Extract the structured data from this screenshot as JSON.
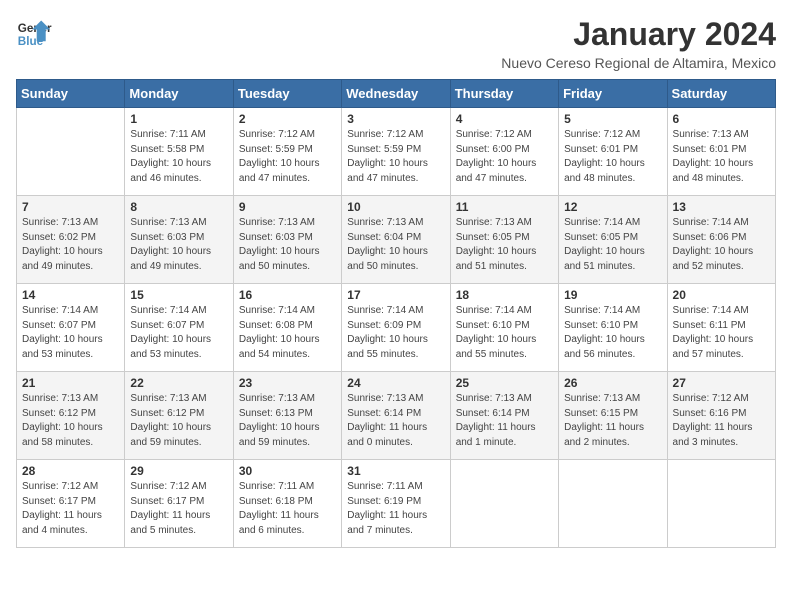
{
  "logo": {
    "line1": "General",
    "line2": "Blue"
  },
  "title": "January 2024",
  "subtitle": "Nuevo Cereso Regional de Altamira, Mexico",
  "days_header": [
    "Sunday",
    "Monday",
    "Tuesday",
    "Wednesday",
    "Thursday",
    "Friday",
    "Saturday"
  ],
  "weeks": [
    [
      {
        "day": "",
        "info": ""
      },
      {
        "day": "1",
        "info": "Sunrise: 7:11 AM\nSunset: 5:58 PM\nDaylight: 10 hours\nand 46 minutes."
      },
      {
        "day": "2",
        "info": "Sunrise: 7:12 AM\nSunset: 5:59 PM\nDaylight: 10 hours\nand 47 minutes."
      },
      {
        "day": "3",
        "info": "Sunrise: 7:12 AM\nSunset: 5:59 PM\nDaylight: 10 hours\nand 47 minutes."
      },
      {
        "day": "4",
        "info": "Sunrise: 7:12 AM\nSunset: 6:00 PM\nDaylight: 10 hours\nand 47 minutes."
      },
      {
        "day": "5",
        "info": "Sunrise: 7:12 AM\nSunset: 6:01 PM\nDaylight: 10 hours\nand 48 minutes."
      },
      {
        "day": "6",
        "info": "Sunrise: 7:13 AM\nSunset: 6:01 PM\nDaylight: 10 hours\nand 48 minutes."
      }
    ],
    [
      {
        "day": "7",
        "info": "Sunrise: 7:13 AM\nSunset: 6:02 PM\nDaylight: 10 hours\nand 49 minutes."
      },
      {
        "day": "8",
        "info": "Sunrise: 7:13 AM\nSunset: 6:03 PM\nDaylight: 10 hours\nand 49 minutes."
      },
      {
        "day": "9",
        "info": "Sunrise: 7:13 AM\nSunset: 6:03 PM\nDaylight: 10 hours\nand 50 minutes."
      },
      {
        "day": "10",
        "info": "Sunrise: 7:13 AM\nSunset: 6:04 PM\nDaylight: 10 hours\nand 50 minutes."
      },
      {
        "day": "11",
        "info": "Sunrise: 7:13 AM\nSunset: 6:05 PM\nDaylight: 10 hours\nand 51 minutes."
      },
      {
        "day": "12",
        "info": "Sunrise: 7:14 AM\nSunset: 6:05 PM\nDaylight: 10 hours\nand 51 minutes."
      },
      {
        "day": "13",
        "info": "Sunrise: 7:14 AM\nSunset: 6:06 PM\nDaylight: 10 hours\nand 52 minutes."
      }
    ],
    [
      {
        "day": "14",
        "info": "Sunrise: 7:14 AM\nSunset: 6:07 PM\nDaylight: 10 hours\nand 53 minutes."
      },
      {
        "day": "15",
        "info": "Sunrise: 7:14 AM\nSunset: 6:07 PM\nDaylight: 10 hours\nand 53 minutes."
      },
      {
        "day": "16",
        "info": "Sunrise: 7:14 AM\nSunset: 6:08 PM\nDaylight: 10 hours\nand 54 minutes."
      },
      {
        "day": "17",
        "info": "Sunrise: 7:14 AM\nSunset: 6:09 PM\nDaylight: 10 hours\nand 55 minutes."
      },
      {
        "day": "18",
        "info": "Sunrise: 7:14 AM\nSunset: 6:10 PM\nDaylight: 10 hours\nand 55 minutes."
      },
      {
        "day": "19",
        "info": "Sunrise: 7:14 AM\nSunset: 6:10 PM\nDaylight: 10 hours\nand 56 minutes."
      },
      {
        "day": "20",
        "info": "Sunrise: 7:14 AM\nSunset: 6:11 PM\nDaylight: 10 hours\nand 57 minutes."
      }
    ],
    [
      {
        "day": "21",
        "info": "Sunrise: 7:13 AM\nSunset: 6:12 PM\nDaylight: 10 hours\nand 58 minutes."
      },
      {
        "day": "22",
        "info": "Sunrise: 7:13 AM\nSunset: 6:12 PM\nDaylight: 10 hours\nand 59 minutes."
      },
      {
        "day": "23",
        "info": "Sunrise: 7:13 AM\nSunset: 6:13 PM\nDaylight: 10 hours\nand 59 minutes."
      },
      {
        "day": "24",
        "info": "Sunrise: 7:13 AM\nSunset: 6:14 PM\nDaylight: 11 hours\nand 0 minutes."
      },
      {
        "day": "25",
        "info": "Sunrise: 7:13 AM\nSunset: 6:14 PM\nDaylight: 11 hours\nand 1 minute."
      },
      {
        "day": "26",
        "info": "Sunrise: 7:13 AM\nSunset: 6:15 PM\nDaylight: 11 hours\nand 2 minutes."
      },
      {
        "day": "27",
        "info": "Sunrise: 7:12 AM\nSunset: 6:16 PM\nDaylight: 11 hours\nand 3 minutes."
      }
    ],
    [
      {
        "day": "28",
        "info": "Sunrise: 7:12 AM\nSunset: 6:17 PM\nDaylight: 11 hours\nand 4 minutes."
      },
      {
        "day": "29",
        "info": "Sunrise: 7:12 AM\nSunset: 6:17 PM\nDaylight: 11 hours\nand 5 minutes."
      },
      {
        "day": "30",
        "info": "Sunrise: 7:11 AM\nSunset: 6:18 PM\nDaylight: 11 hours\nand 6 minutes."
      },
      {
        "day": "31",
        "info": "Sunrise: 7:11 AM\nSunset: 6:19 PM\nDaylight: 11 hours\nand 7 minutes."
      },
      {
        "day": "",
        "info": ""
      },
      {
        "day": "",
        "info": ""
      },
      {
        "day": "",
        "info": ""
      }
    ]
  ]
}
